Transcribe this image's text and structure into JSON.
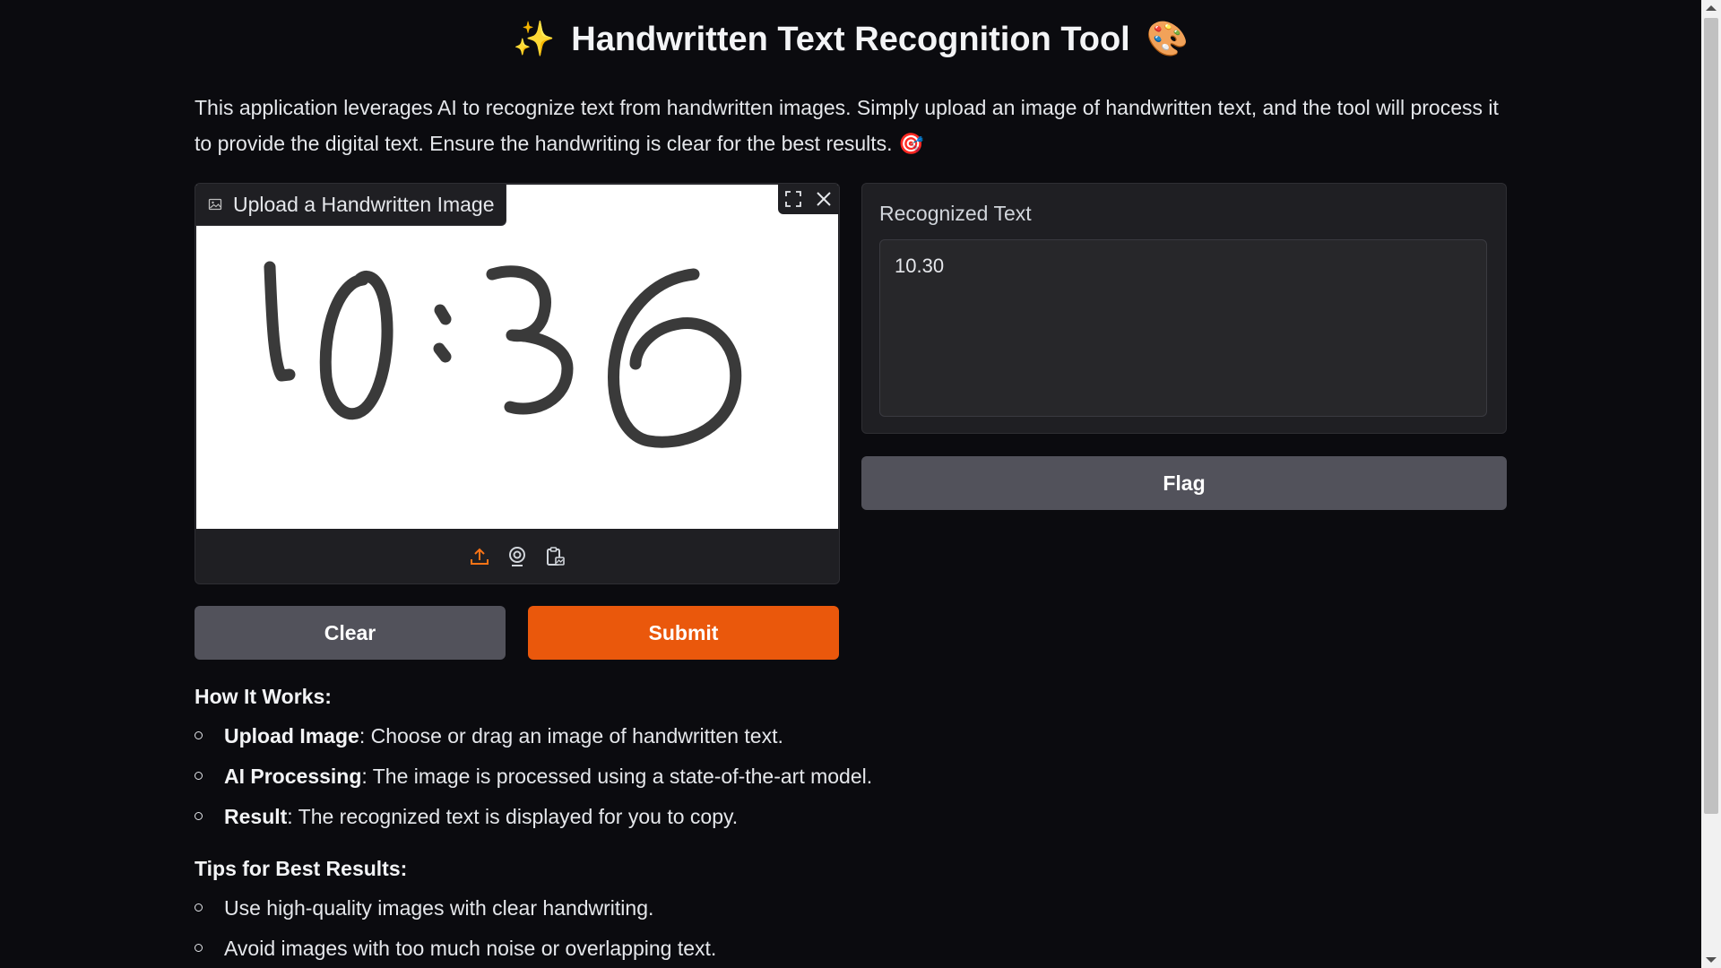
{
  "header": {
    "title": "Handwritten Text Recognition Tool",
    "title_prefix_emoji": "✨",
    "title_suffix_emoji": "🎨",
    "intro": "This application leverages AI to recognize text from handwritten images. Simply upload an image of handwritten text, and the tool will process it to provide the digital text. Ensure the handwriting is clear for the best results.",
    "intro_emoji": "🎯"
  },
  "upload": {
    "label": "Upload a Handwritten Image",
    "handwritten_content": "10:36",
    "icons": [
      "image-icon",
      "fullscreen-icon",
      "close-icon",
      "upload-icon",
      "webcam-icon",
      "clipboard-icon"
    ]
  },
  "buttons": {
    "clear": "Clear",
    "submit": "Submit",
    "flag": "Flag"
  },
  "output": {
    "label": "Recognized Text",
    "value": "10.30"
  },
  "how_it_works": {
    "heading": "How It Works:",
    "items": [
      {
        "bold": "Upload Image",
        "text": ": Choose or drag an image of handwritten text."
      },
      {
        "bold": "AI Processing",
        "text": ": The image is processed using a state-of-the-art model."
      },
      {
        "bold": "Result",
        "text": ": The recognized text is displayed for you to copy."
      }
    ]
  },
  "tips": {
    "heading": "Tips for Best Results:",
    "items": [
      "Use high-quality images with clear handwriting.",
      "Avoid images with too much noise or overlapping text."
    ]
  },
  "colors": {
    "background": "#0b0b0f",
    "panel": "#1f1f23",
    "accent": "#ea580c",
    "secondary_button": "#52525b"
  }
}
